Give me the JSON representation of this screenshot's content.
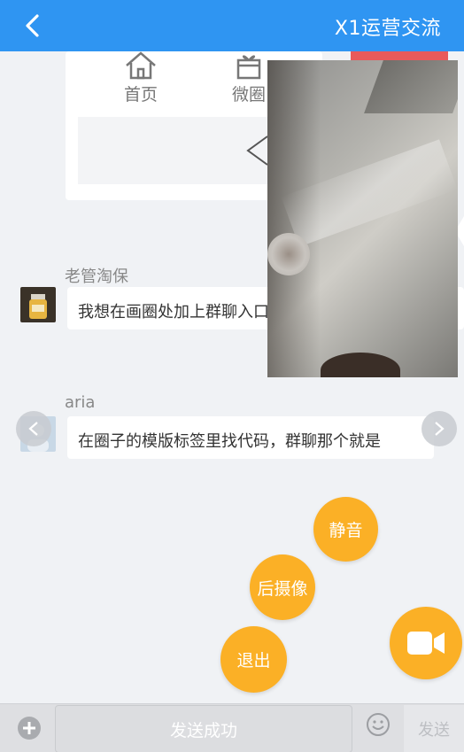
{
  "header": {
    "title": "X1运营交流"
  },
  "shared_card": {
    "nav_items": [
      {
        "label": "首页",
        "icon": "home-icon"
      },
      {
        "label": "微圈",
        "icon": "gift-icon"
      }
    ]
  },
  "messages": [
    {
      "sender": "老管淘保",
      "text": "我想在画圈处加上群聊入口，请问在哪里编辑",
      "avatar_icon": "bottle-avatar"
    },
    {
      "sender": "aria",
      "text": "在圈子的模版标签里找代码，群聊那个就是",
      "avatar_icon": "user-avatar"
    }
  ],
  "video_controls": {
    "mute_label": "静音",
    "rear_camera_label": "后摄像",
    "exit_label": "退出",
    "video_icon": "video-camera-icon"
  },
  "input_bar": {
    "toast_text": "发送成功",
    "send_label": "发送"
  },
  "colors": {
    "header_bg": "#2f95f2",
    "fab_orange": "#fbb026"
  }
}
